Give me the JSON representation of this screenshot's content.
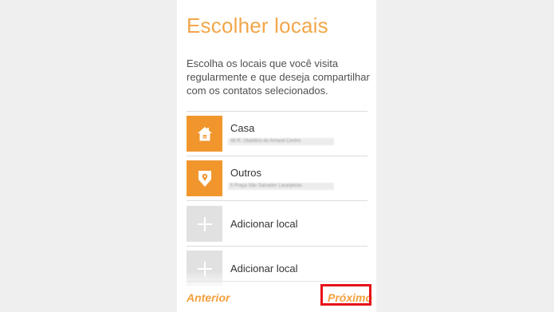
{
  "screen": {
    "title": "Escolher locais",
    "description": "Escolha os locais que você visita regularmente e que deseja compartilhar com os contatos selecionados."
  },
  "locations": [
    {
      "name": "Casa",
      "address": "48 R. Ubaldino do Amaral Centro",
      "icon": "home-icon",
      "type": "set"
    },
    {
      "name": "Outros",
      "address": "5 Praça São Salvador Laranjeiras",
      "icon": "map-pin-icon",
      "type": "set"
    },
    {
      "name": "Adicionar local",
      "icon": "plus-icon",
      "type": "add"
    },
    {
      "name": "Adicionar local",
      "icon": "plus-icon",
      "type": "add"
    }
  ],
  "nav": {
    "previous_label": "Anterior",
    "next_label": "Próximo"
  },
  "colors": {
    "accent": "#f0962d",
    "title": "#f3a64a",
    "placeholder_tile": "#e1e1e1",
    "highlight": "#e8101a"
  }
}
